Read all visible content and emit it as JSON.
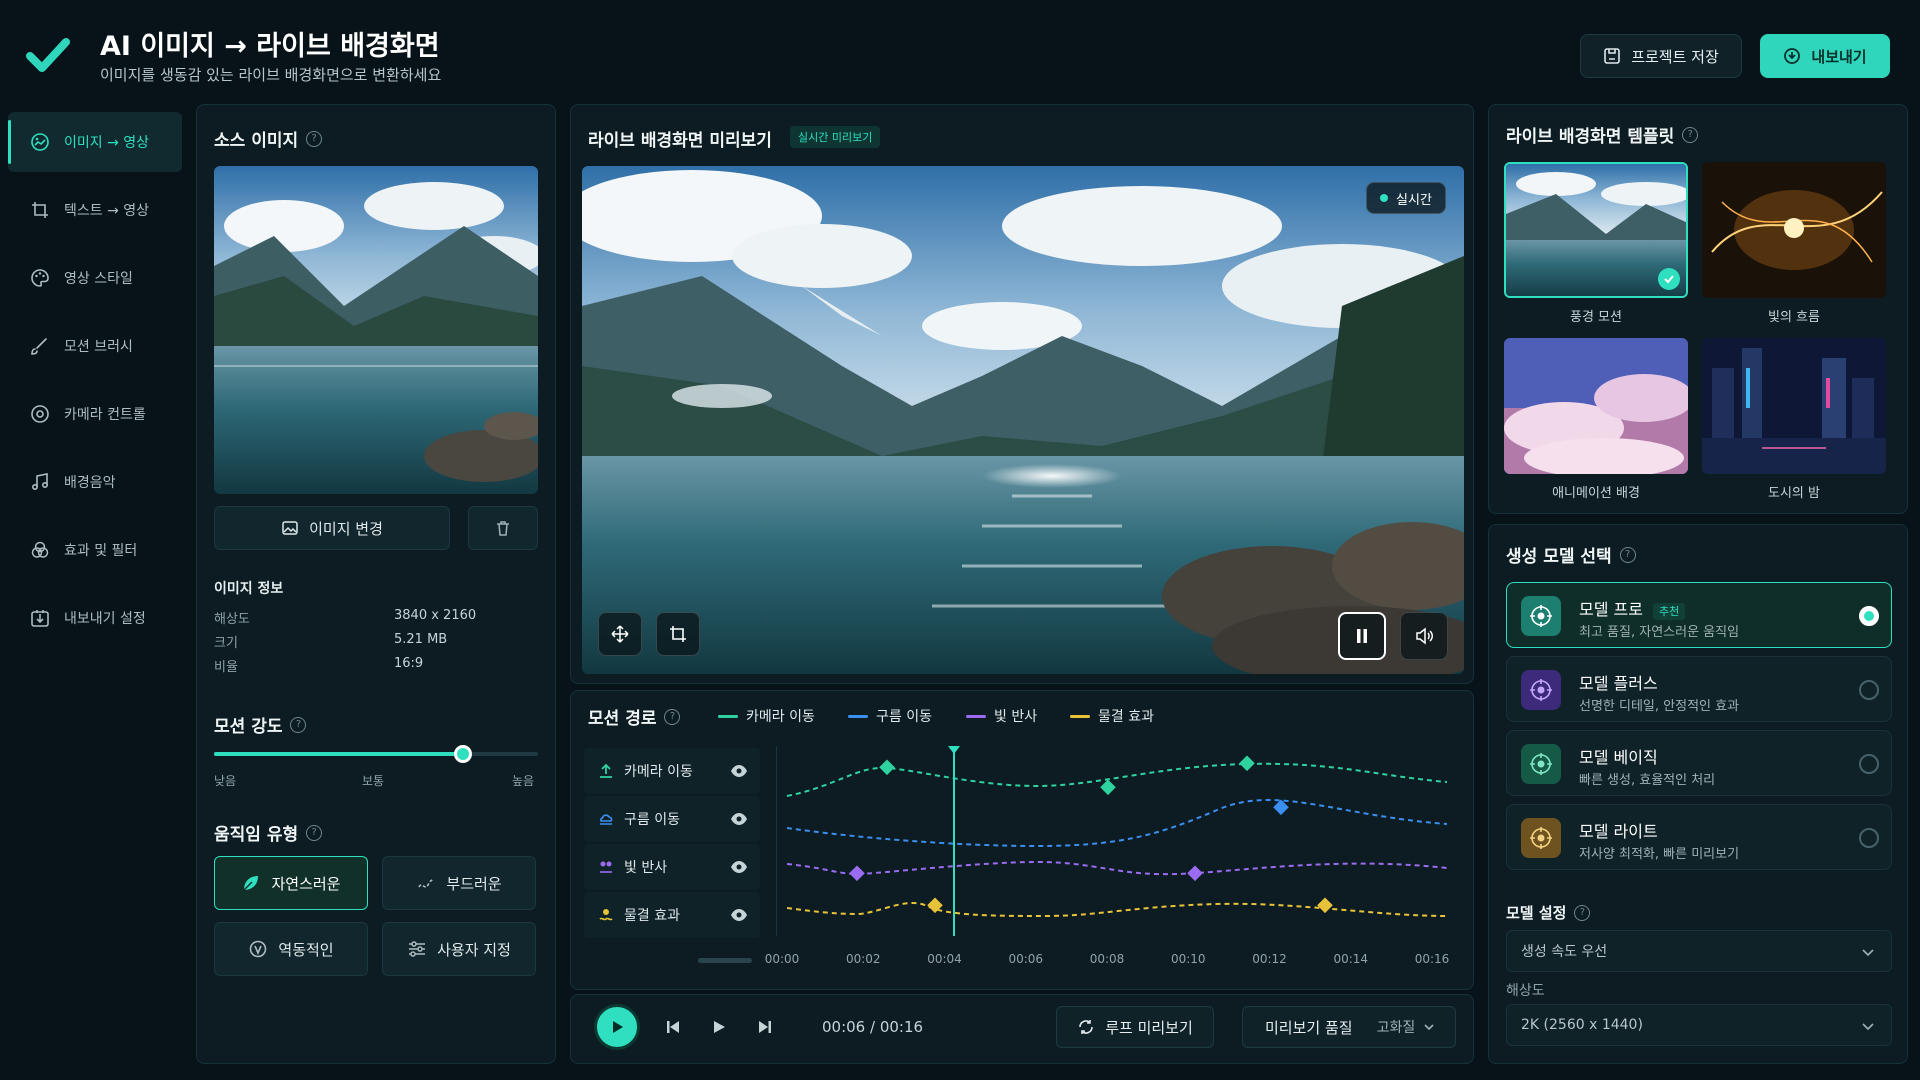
{
  "header": {
    "title": "AI 이미지 → 라이브 배경화면",
    "subtitle": "이미지를 생동감 있는 라이브 배경화면으로 변환하세요",
    "save_label": "프로젝트 저장",
    "export_label": "내보내기"
  },
  "sidebar": {
    "items": [
      {
        "label": "이미지 → 영상",
        "icon": "image-video-icon",
        "active": true
      },
      {
        "label": "텍스트 → 영상",
        "icon": "text-crop-icon"
      },
      {
        "label": "영상 스타일",
        "icon": "palette-icon"
      },
      {
        "label": "모션 브러시",
        "icon": "brush-icon"
      },
      {
        "label": "카메라 컨트롤",
        "icon": "camera-target-icon"
      },
      {
        "label": "배경음악",
        "icon": "music-note-icon"
      },
      {
        "label": "효과 및 필터",
        "icon": "filter-circles-icon"
      },
      {
        "label": "내보내기 설정",
        "icon": "export-settings-icon"
      }
    ]
  },
  "source": {
    "title": "소스 이미지",
    "change_label": "이미지 변경",
    "info_title": "이미지 정보",
    "info": [
      {
        "label": "해상도",
        "value": "3840 x 2160"
      },
      {
        "label": "크기",
        "value": "5.21 MB"
      },
      {
        "label": "비율",
        "value": "16:9"
      }
    ],
    "motion_title": "모션 강도",
    "motion_value": 0.77,
    "slider_labels": [
      "낮음",
      "보통",
      "높음"
    ],
    "movement_title": "움직임 유형",
    "movement_options": [
      {
        "label": "자연스러운",
        "icon": "leaf-icon",
        "active": true
      },
      {
        "label": "부드러운",
        "icon": "soft-wave-icon"
      },
      {
        "label": "역동적인",
        "icon": "dynamic-icon"
      },
      {
        "label": "사용자 지정",
        "icon": "sliders-icon"
      }
    ]
  },
  "preview": {
    "title": "라이브 배경화면 미리보기",
    "badge": "실시간 미리보기",
    "live_label": "실시간"
  },
  "timeline": {
    "title": "모션 경로",
    "legend": [
      {
        "label": "카메라 이동",
        "color": "#2ed3a0"
      },
      {
        "label": "구름 이동",
        "color": "#3b8ff0"
      },
      {
        "label": "빛 반사",
        "color": "#9b6cf2"
      },
      {
        "label": "물결 효과",
        "color": "#e8c33a"
      }
    ],
    "tracks": [
      "카메라 이동",
      "구름 이동",
      "빛 반사",
      "물결 효과"
    ],
    "ticks": [
      "00:00",
      "00:02",
      "00:04",
      "00:06",
      "00:08",
      "00:10",
      "00:12",
      "00:14",
      "00:16"
    ]
  },
  "playback": {
    "time": "00:06 / 00:16",
    "loop_label": "루프 미리보기",
    "quality_label": "미리보기 품질",
    "quality_value": "고화질"
  },
  "templates": {
    "title": "라이브 배경화면 템플릿",
    "items": [
      "풍경 모션",
      "빛의 흐름",
      "애니메이션 배경",
      "도시의 밤"
    ]
  },
  "models": {
    "title": "생성 모델 선택",
    "items": [
      {
        "name": "모델 프로",
        "tag": "추천",
        "desc": "최고 품질, 자연스러운 움직임",
        "color": "#2fd6bc",
        "selected": true
      },
      {
        "name": "모델 플러스",
        "desc": "선명한 디테일, 안정적인 효과",
        "color": "#8b5cf6"
      },
      {
        "name": "모델 베이직",
        "desc": "빠른 생성, 효율적인 처리",
        "color": "#22b48a"
      },
      {
        "name": "모델 라이트",
        "desc": "저사양 최적화, 빠른 미리보기",
        "color": "#d9a53a"
      }
    ]
  },
  "settings": {
    "title": "모델 설정",
    "speed_value": "생성 속도 우선",
    "resolution_label": "해상도",
    "resolution_value": "2K (2560 x 1440)"
  }
}
